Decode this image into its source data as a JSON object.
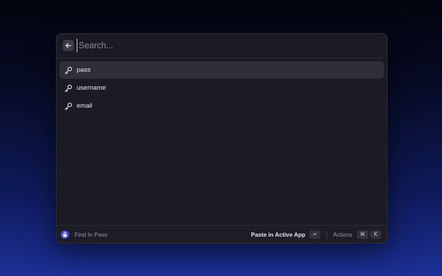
{
  "search": {
    "placeholder": "Search..."
  },
  "results": [
    {
      "label": "pass",
      "icon": "key-icon",
      "selected": true
    },
    {
      "label": "username",
      "icon": "key-icon",
      "selected": false
    },
    {
      "label": "email",
      "icon": "key-icon",
      "selected": false
    }
  ],
  "footer": {
    "app_icon": "lock-icon",
    "title": "Find In Pass",
    "primary_action": "Paste in Active App",
    "primary_key": "↵",
    "actions_label": "Actions",
    "actions_keys": [
      "⌘",
      "K"
    ]
  },
  "colors": {
    "accent": "#4a4fd8",
    "window_bg": "#1a1b24",
    "selected_bg": "#2e2f3b"
  }
}
